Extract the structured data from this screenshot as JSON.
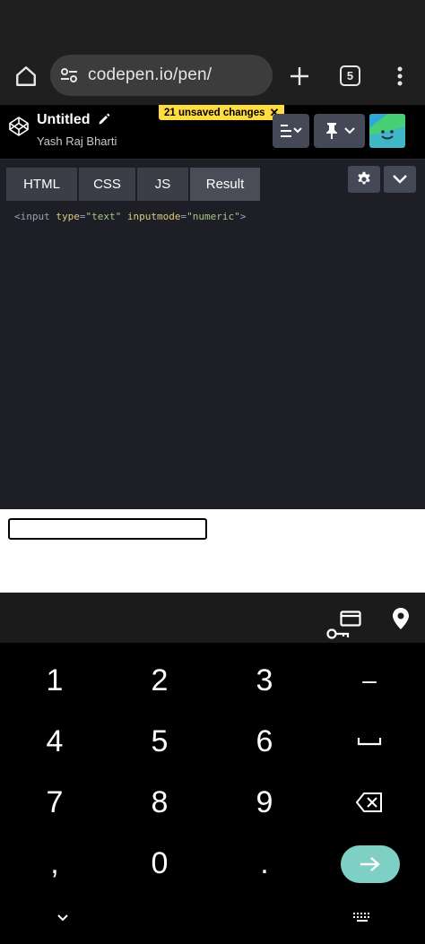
{
  "browser": {
    "url": "codepen.io/pen/",
    "tab_count": "5"
  },
  "pen": {
    "title": "Untitled",
    "author": "Yash Raj Bharti",
    "unsaved_label": "21 unsaved changes",
    "unsaved_close": "✕"
  },
  "editor_tabs": {
    "html": "HTML",
    "css": "CSS",
    "js": "JS",
    "result": "Result"
  },
  "code": {
    "tag_open": "<input",
    "attr1": "type",
    "val1": "\"text\"",
    "attr2": "inputmode",
    "val2": "\"numeric\"",
    "tag_close": ">"
  },
  "keyboard": {
    "k1": "1",
    "k2": "2",
    "k3": "3",
    "dash": "–",
    "k4": "4",
    "k5": "5",
    "k6": "6",
    "k7": "7",
    "k8": "8",
    "k9": "9",
    "comma": ",",
    "k0": "0",
    "period": "."
  },
  "colors": {
    "accent_yellow": "#ffdd40",
    "enter_key": "#7ed0c4",
    "editor_bg": "#1e1f26",
    "button_bg": "#444857"
  },
  "icons": {
    "home": "home-icon",
    "site_settings": "tune-icon",
    "new_tab": "plus-icon",
    "more": "more-vert-icon",
    "codepen": "codepen-logo",
    "edit": "pencil-icon",
    "layout": "layout-icon",
    "pin": "pin-icon",
    "settings": "gear-icon",
    "collapse": "chevron-down-icon",
    "password": "key-icon",
    "payment": "credit-card-icon",
    "location": "location-pin-icon",
    "backspace": "backspace-icon",
    "enter": "arrow-right-icon",
    "hide_keyboard": "chevron-down-icon",
    "switch_keyboard": "keyboard-icon"
  }
}
